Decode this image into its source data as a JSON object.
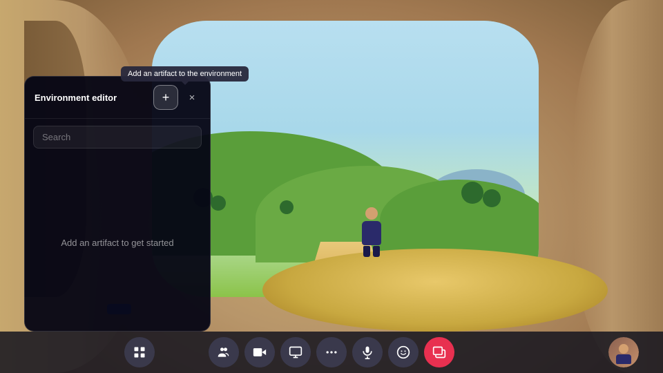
{
  "scene": {
    "description": "3D virtual environment - sandy room with window view"
  },
  "tooltip": {
    "text": "Add an artifact to the environment"
  },
  "panel": {
    "title": "Environment editor",
    "search_placeholder": "Search",
    "empty_state": "Add an artifact to get started",
    "add_button_label": "+",
    "close_button_label": "×"
  },
  "toolbar": {
    "left_btn_icon": "grid-icon",
    "btn1_icon": "people-icon",
    "btn2_icon": "camera-icon",
    "btn3_icon": "content-icon",
    "btn4_icon": "more-icon",
    "btn5_icon": "mic-icon",
    "btn6_icon": "emoji-icon",
    "btn7_icon": "share-icon",
    "right_btn_icon": "avatar-icon",
    "colors": {
      "dark_btn": "#3c3c50",
      "red_btn": "#e83050"
    }
  }
}
